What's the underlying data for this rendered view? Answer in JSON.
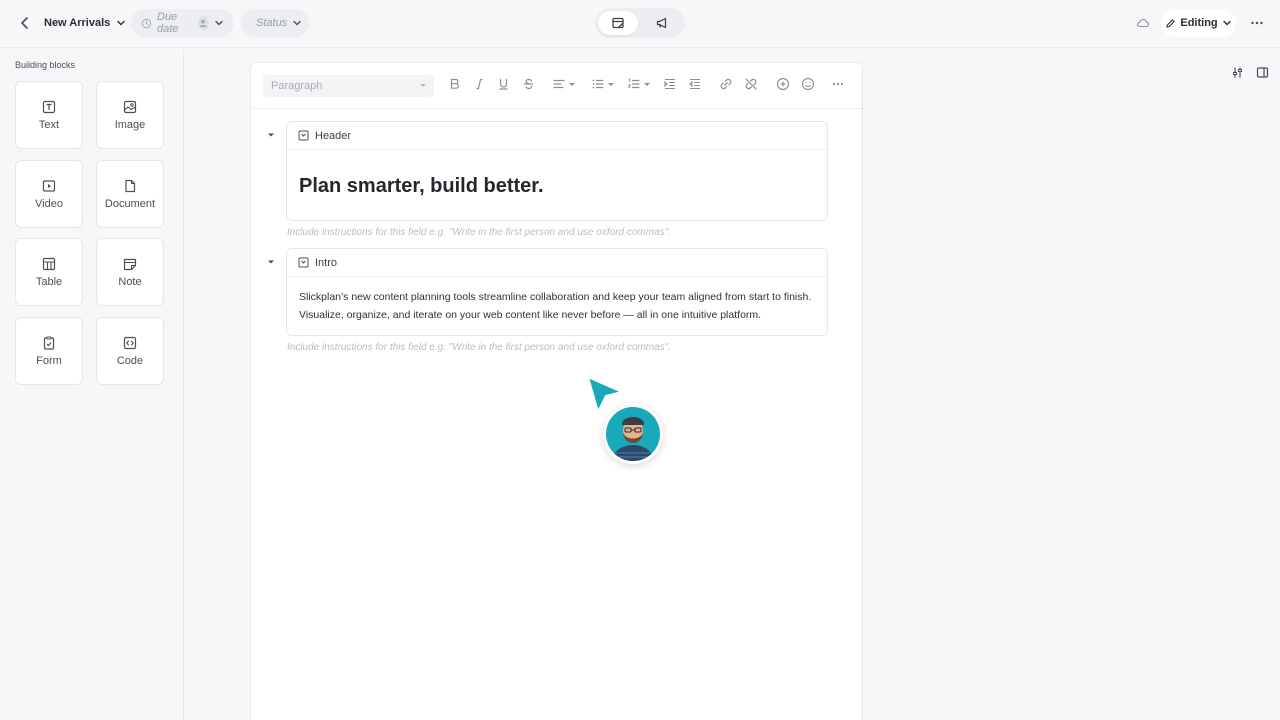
{
  "header": {
    "title": "New Arrivals",
    "due_date_placeholder": "Due date",
    "status_placeholder": "Status",
    "mode_label": "Editing"
  },
  "sidebar": {
    "heading": "Building blocks",
    "blocks": [
      {
        "label": "Text",
        "icon": "text-block-icon"
      },
      {
        "label": "Image",
        "icon": "image-icon"
      },
      {
        "label": "Video",
        "icon": "video-icon"
      },
      {
        "label": "Document",
        "icon": "document-icon"
      },
      {
        "label": "Table",
        "icon": "table-icon"
      },
      {
        "label": "Note",
        "icon": "note-icon"
      },
      {
        "label": "Form",
        "icon": "form-icon"
      },
      {
        "label": "Code",
        "icon": "code-icon"
      }
    ]
  },
  "toolbar": {
    "paragraph_style": "Paragraph"
  },
  "content": {
    "sections": [
      {
        "label": "Header",
        "text": "Plan smarter, build better.",
        "hint": "Include instructions for this field e.g. \"Write in the first person and use oxford commas\"."
      },
      {
        "label": "Intro",
        "text": "Slickplan’s new content planning tools streamline collaboration and keep your team aligned from start to finish. Visualize, organize, and iterate on your web content like never before — all in one intuitive platform.",
        "hint": "Include instructions for this field e.g. \"Write in the first person and use oxford commas\"."
      }
    ]
  },
  "colors": {
    "accent": "#1aa9b8",
    "background": "#f6f7f9",
    "card": "#ffffff"
  }
}
